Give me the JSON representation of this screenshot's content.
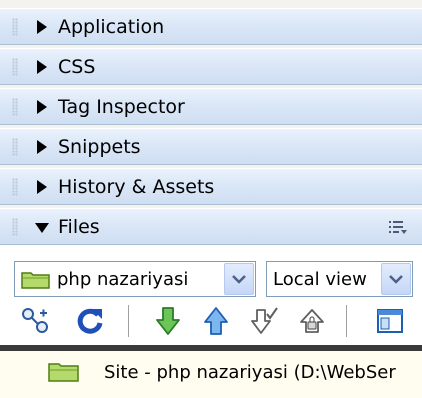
{
  "panels": [
    {
      "title": "Application",
      "expanded": false
    },
    {
      "title": "CSS",
      "expanded": false
    },
    {
      "title": "Tag Inspector",
      "expanded": false
    },
    {
      "title": "Snippets",
      "expanded": false
    },
    {
      "title": "History & Assets",
      "expanded": false
    },
    {
      "title": "Files",
      "expanded": true
    }
  ],
  "files": {
    "site_select": {
      "value": "php nazariyasi"
    },
    "view_select": {
      "value": "Local view"
    },
    "toolbar": [
      {
        "name": "connect-icon"
      },
      {
        "name": "refresh-icon"
      },
      {
        "name": "get-files-icon"
      },
      {
        "name": "put-files-icon"
      },
      {
        "name": "check-out-icon"
      },
      {
        "name": "check-in-icon"
      },
      {
        "name": "expand-site-icon"
      }
    ],
    "tree": {
      "site_label": "Site - php nazariyasi (D:\\WebSer"
    }
  },
  "colors": {
    "header_top": "#ebf3fd",
    "header_bottom": "#cfdef2",
    "folder_green": "#8fc23b",
    "arrow_green": "#3aa842",
    "arrow_blue": "#2f7fd6"
  }
}
